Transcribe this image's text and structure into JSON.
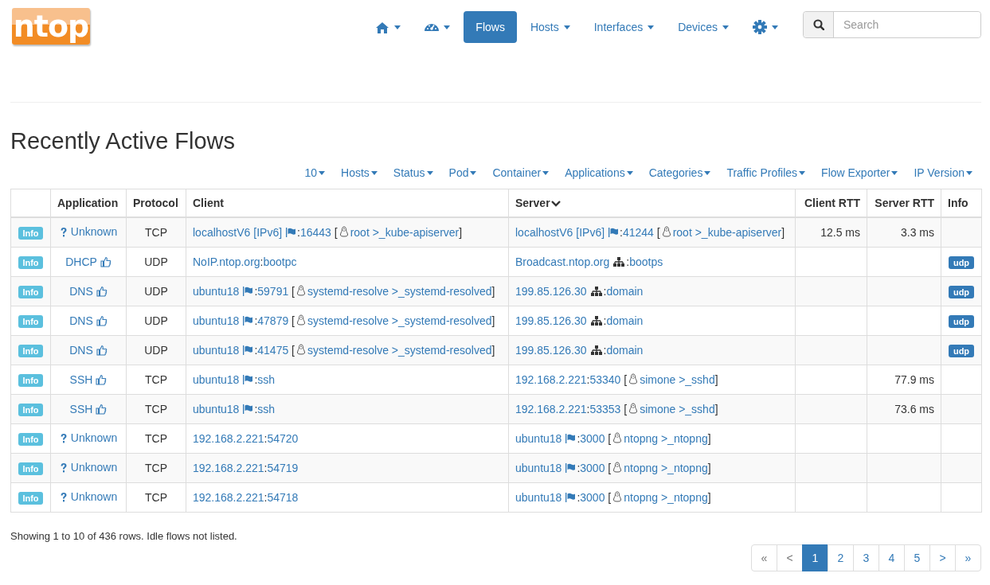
{
  "logo": {
    "text": "ntop"
  },
  "nav": [
    {
      "kind": "home",
      "selected": false,
      "dropdown": true
    },
    {
      "kind": "dashboard",
      "selected": false,
      "dropdown": true
    },
    {
      "kind": "text",
      "label": "Flows",
      "selected": true,
      "dropdown": false
    },
    {
      "kind": "text",
      "label": "Hosts",
      "selected": false,
      "dropdown": true
    },
    {
      "kind": "text",
      "label": "Interfaces",
      "selected": false,
      "dropdown": true
    },
    {
      "kind": "text",
      "label": "Devices",
      "selected": false,
      "dropdown": true
    },
    {
      "kind": "settings",
      "selected": false,
      "dropdown": true
    }
  ],
  "search": {
    "placeholder": "Search"
  },
  "title": "Recently Active Flows",
  "filters": [
    "10",
    "Hosts",
    "Status",
    "Pod",
    "Container",
    "Applications",
    "Categories",
    "Traffic Profiles",
    "Flow Exporter",
    "IP Version"
  ],
  "table": {
    "columns": [
      {
        "sorted": false
      },
      {
        "label": "Application",
        "sorted": false
      },
      {
        "label": "Protocol",
        "sorted": false
      },
      {
        "label": "Client",
        "sorted": false
      },
      {
        "label": "Server",
        "sorted": true
      },
      {
        "label": "Client RTT",
        "sorted": false
      },
      {
        "label": "Server RTT",
        "sorted": false
      },
      {
        "label": "Info",
        "sorted": false
      }
    ],
    "rows": [
      {
        "button": "Info",
        "app": {
          "kind": "unknown",
          "name": "Unknown"
        },
        "protocol": "TCP",
        "client": [
          {
            "kind": "host",
            "text": "localhostV6 [IPv6]"
          },
          {
            "kind": "flag"
          },
          {
            "kind": "punct",
            "text": ":"
          },
          {
            "kind": "port",
            "text": "16443"
          },
          {
            "kind": "punct",
            "text": " ["
          },
          {
            "kind": "linux"
          },
          {
            "kind": "process",
            "text": "root >_kube-apiserver"
          },
          {
            "kind": "punct",
            "text": "]"
          }
        ],
        "server": [
          {
            "kind": "host",
            "text": "localhostV6 [IPv6]"
          },
          {
            "kind": "flag"
          },
          {
            "kind": "punct",
            "text": ":"
          },
          {
            "kind": "port",
            "text": "41244"
          },
          {
            "kind": "punct",
            "text": " ["
          },
          {
            "kind": "linux"
          },
          {
            "kind": "process",
            "text": "root >_kube-apiserver"
          },
          {
            "kind": "punct",
            "text": "]"
          }
        ],
        "client_rtt": "12.5 ms",
        "server_rtt": "3.3 ms"
      },
      {
        "button": "Info",
        "app": {
          "kind": "good",
          "name": "DHCP"
        },
        "protocol": "UDP",
        "client": [
          {
            "kind": "host",
            "text": "NoIP.ntop.org"
          },
          {
            "kind": "punct",
            "text": ":"
          },
          {
            "kind": "port",
            "text": "bootpc"
          }
        ],
        "server": [
          {
            "kind": "host",
            "text": "Broadcast.ntop.org"
          },
          {
            "kind": "network"
          },
          {
            "kind": "punct",
            "text": ":"
          },
          {
            "kind": "port",
            "text": "bootps"
          }
        ],
        "info": "udp"
      },
      {
        "button": "Info",
        "app": {
          "kind": "good",
          "name": "DNS"
        },
        "protocol": "UDP",
        "client": [
          {
            "kind": "host",
            "text": "ubuntu18"
          },
          {
            "kind": "flag"
          },
          {
            "kind": "punct",
            "text": ":"
          },
          {
            "kind": "port",
            "text": "59791"
          },
          {
            "kind": "punct",
            "text": " ["
          },
          {
            "kind": "linux"
          },
          {
            "kind": "process",
            "text": "systemd-resolve >_systemd-resolved"
          },
          {
            "kind": "punct",
            "text": "]"
          }
        ],
        "server": [
          {
            "kind": "host",
            "text": "199.85.126.30"
          },
          {
            "kind": "network"
          },
          {
            "kind": "punct",
            "text": ":"
          },
          {
            "kind": "port",
            "text": "domain"
          }
        ],
        "info": "udp"
      },
      {
        "button": "Info",
        "app": {
          "kind": "good",
          "name": "DNS"
        },
        "protocol": "UDP",
        "client": [
          {
            "kind": "host",
            "text": "ubuntu18"
          },
          {
            "kind": "flag"
          },
          {
            "kind": "punct",
            "text": ":"
          },
          {
            "kind": "port",
            "text": "47879"
          },
          {
            "kind": "punct",
            "text": " ["
          },
          {
            "kind": "linux"
          },
          {
            "kind": "process",
            "text": "systemd-resolve >_systemd-resolved"
          },
          {
            "kind": "punct",
            "text": "]"
          }
        ],
        "server": [
          {
            "kind": "host",
            "text": "199.85.126.30"
          },
          {
            "kind": "network"
          },
          {
            "kind": "punct",
            "text": ":"
          },
          {
            "kind": "port",
            "text": "domain"
          }
        ],
        "info": "udp"
      },
      {
        "button": "Info",
        "app": {
          "kind": "good",
          "name": "DNS"
        },
        "protocol": "UDP",
        "client": [
          {
            "kind": "host",
            "text": "ubuntu18"
          },
          {
            "kind": "flag"
          },
          {
            "kind": "punct",
            "text": ":"
          },
          {
            "kind": "port",
            "text": "41475"
          },
          {
            "kind": "punct",
            "text": " ["
          },
          {
            "kind": "linux"
          },
          {
            "kind": "process",
            "text": "systemd-resolve >_systemd-resolved"
          },
          {
            "kind": "punct",
            "text": "]"
          }
        ],
        "server": [
          {
            "kind": "host",
            "text": "199.85.126.30"
          },
          {
            "kind": "network"
          },
          {
            "kind": "punct",
            "text": ":"
          },
          {
            "kind": "port",
            "text": "domain"
          }
        ],
        "info": "udp"
      },
      {
        "button": "Info",
        "app": {
          "kind": "good",
          "name": "SSH"
        },
        "protocol": "TCP",
        "client": [
          {
            "kind": "host",
            "text": "ubuntu18"
          },
          {
            "kind": "flag"
          },
          {
            "kind": "punct",
            "text": ":"
          },
          {
            "kind": "port",
            "text": "ssh"
          }
        ],
        "server": [
          {
            "kind": "host",
            "text": "192.168.2.221"
          },
          {
            "kind": "punct",
            "text": ":"
          },
          {
            "kind": "port",
            "text": "53340"
          },
          {
            "kind": "punct",
            "text": " ["
          },
          {
            "kind": "linux"
          },
          {
            "kind": "process",
            "text": "simone >_sshd"
          },
          {
            "kind": "punct",
            "text": "]"
          }
        ],
        "server_rtt": "77.9 ms"
      },
      {
        "button": "Info",
        "app": {
          "kind": "good",
          "name": "SSH"
        },
        "protocol": "TCP",
        "client": [
          {
            "kind": "host",
            "text": "ubuntu18"
          },
          {
            "kind": "flag"
          },
          {
            "kind": "punct",
            "text": ":"
          },
          {
            "kind": "port",
            "text": "ssh"
          }
        ],
        "server": [
          {
            "kind": "host",
            "text": "192.168.2.221"
          },
          {
            "kind": "punct",
            "text": ":"
          },
          {
            "kind": "port",
            "text": "53353"
          },
          {
            "kind": "punct",
            "text": " ["
          },
          {
            "kind": "linux"
          },
          {
            "kind": "process",
            "text": "simone >_sshd"
          },
          {
            "kind": "punct",
            "text": "]"
          }
        ],
        "server_rtt": "73.6 ms"
      },
      {
        "button": "Info",
        "app": {
          "kind": "unknown",
          "name": "Unknown"
        },
        "protocol": "TCP",
        "client": [
          {
            "kind": "host",
            "text": "192.168.2.221"
          },
          {
            "kind": "punct",
            "text": ":"
          },
          {
            "kind": "port",
            "text": "54720"
          }
        ],
        "server": [
          {
            "kind": "host",
            "text": "ubuntu18"
          },
          {
            "kind": "flag"
          },
          {
            "kind": "punct",
            "text": ":"
          },
          {
            "kind": "port",
            "text": "3000"
          },
          {
            "kind": "punct",
            "text": " ["
          },
          {
            "kind": "linux"
          },
          {
            "kind": "process",
            "text": "ntopng >_ntopng"
          },
          {
            "kind": "punct",
            "text": "]"
          }
        ]
      },
      {
        "button": "Info",
        "app": {
          "kind": "unknown",
          "name": "Unknown"
        },
        "protocol": "TCP",
        "client": [
          {
            "kind": "host",
            "text": "192.168.2.221"
          },
          {
            "kind": "punct",
            "text": ":"
          },
          {
            "kind": "port",
            "text": "54719"
          }
        ],
        "server": [
          {
            "kind": "host",
            "text": "ubuntu18"
          },
          {
            "kind": "flag"
          },
          {
            "kind": "punct",
            "text": ":"
          },
          {
            "kind": "port",
            "text": "3000"
          },
          {
            "kind": "punct",
            "text": " ["
          },
          {
            "kind": "linux"
          },
          {
            "kind": "process",
            "text": "ntopng >_ntopng"
          },
          {
            "kind": "punct",
            "text": "]"
          }
        ]
      },
      {
        "button": "Info",
        "app": {
          "kind": "unknown",
          "name": "Unknown"
        },
        "protocol": "TCP",
        "client": [
          {
            "kind": "host",
            "text": "192.168.2.221"
          },
          {
            "kind": "punct",
            "text": ":"
          },
          {
            "kind": "port",
            "text": "54718"
          }
        ],
        "server": [
          {
            "kind": "host",
            "text": "ubuntu18"
          },
          {
            "kind": "flag"
          },
          {
            "kind": "punct",
            "text": ":"
          },
          {
            "kind": "port",
            "text": "3000"
          },
          {
            "kind": "punct",
            "text": " ["
          },
          {
            "kind": "linux"
          },
          {
            "kind": "process",
            "text": "ntopng >_ntopng"
          },
          {
            "kind": "punct",
            "text": "]"
          }
        ]
      }
    ]
  },
  "summary": "Showing 1 to 10 of 436 rows. Idle flows not listed.",
  "pagination": [
    {
      "label": "«",
      "selected": false,
      "disabled": true
    },
    {
      "label": "<",
      "selected": false,
      "disabled": true
    },
    {
      "label": "1",
      "selected": true,
      "disabled": false
    },
    {
      "label": "2",
      "selected": false,
      "disabled": false
    },
    {
      "label": "3",
      "selected": false,
      "disabled": false
    },
    {
      "label": "4",
      "selected": false,
      "disabled": false
    },
    {
      "label": "5",
      "selected": false,
      "disabled": false
    },
    {
      "label": ">",
      "selected": false,
      "disabled": false
    },
    {
      "label": "»",
      "selected": false,
      "disabled": false
    }
  ]
}
